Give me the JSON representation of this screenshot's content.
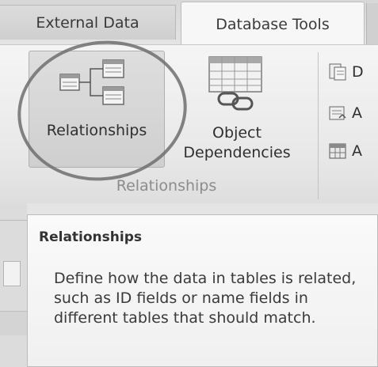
{
  "tabs": {
    "external_data": "External Data",
    "database_tools": "Database Tools"
  },
  "ribbon": {
    "relationships_button": "Relationships",
    "object_dependencies_line1": "Object",
    "object_dependencies_line2": "Dependencies",
    "group_label": "Relationships",
    "small_buttons": [
      "D",
      "A",
      "A"
    ]
  },
  "tooltip": {
    "title": "Relationships",
    "body": "Define how the data in tables is related, such as ID fields or name fields in different tables that should match."
  },
  "icons": {
    "relationships": "relationships-icon",
    "object_dependencies": "object-dependencies-icon",
    "database_documenter": "database-documenter-icon",
    "analyze_performance": "analyze-performance-icon",
    "analyze_table": "analyze-table-icon"
  }
}
